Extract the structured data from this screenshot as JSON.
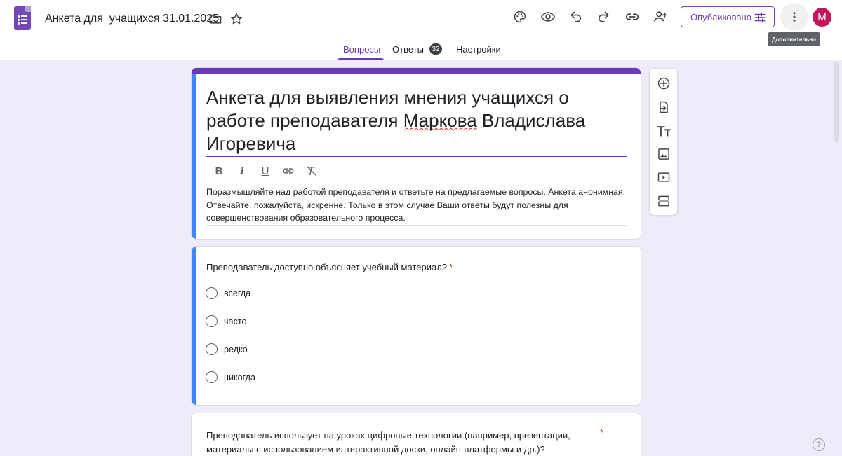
{
  "header": {
    "doc_title": "Анкета для  учащихся 31.01.2025",
    "publish_label": "Опубликовано",
    "avatar_letter": "M",
    "tooltip": "Дополнительно",
    "icons": [
      "forms-logo-icon",
      "folder-icon",
      "star-icon",
      "palette-icon",
      "eye-icon",
      "undo-icon",
      "redo-icon",
      "link-icon",
      "person-add-icon",
      "sliders-icon",
      "more-vert-icon"
    ]
  },
  "tabs": [
    {
      "label": "Вопросы",
      "active": true
    },
    {
      "label": "Ответы",
      "count": "32"
    },
    {
      "label": "Настройки"
    }
  ],
  "form": {
    "title_part1": "Анкета для выявления мнения учащихся о работе преподавателя ",
    "title_spell": "Маркова",
    "title_part2": " Владислава Игоревича",
    "description": "Поразмышляйте над работой преподавателя   и ответьте на предлагаемые вопросы. Анкета анонимная. Отвечайте, пожалуйста, искренне. Только в этом случае Ваши ответы будут полезны для совершенствования образовательного процесса.",
    "format_buttons": [
      "B",
      "I",
      "U"
    ]
  },
  "questions": [
    {
      "text": "Преподаватель доступно объясняет учебный материал?",
      "required_mark": "*",
      "options": [
        "всегда",
        "часто",
        "редко",
        "никогда"
      ]
    },
    {
      "text": "Преподаватель использует на уроках цифровые технологии (например, презентации, материалы с использованием интерактивной доски, онлайн-платформы и др.)?",
      "required_mark": "*"
    }
  ],
  "side_toolbar": [
    "add-question-icon",
    "import-questions-icon",
    "add-title-icon",
    "add-image-icon",
    "add-video-icon",
    "add-section-icon"
  ],
  "help": "?",
  "colors": {
    "accent": "#673ab7",
    "selected": "#4285f4",
    "background": "#f0ebf8",
    "required": "#d93025"
  }
}
